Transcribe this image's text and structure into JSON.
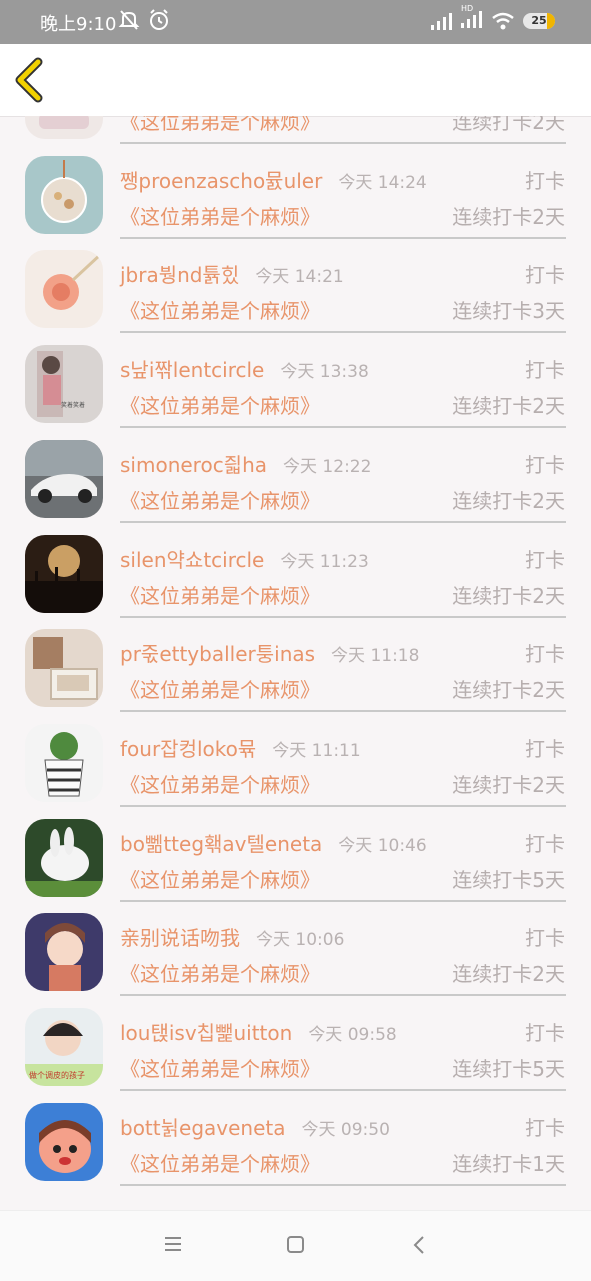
{
  "status_bar": {
    "time": "晚上9:10",
    "battery": "25",
    "network_badge": "HD"
  },
  "header": {
    "back_icon": "chevron-left-icon",
    "accent_color": "#f2d200"
  },
  "records": [
    {
      "name": "",
      "time": "",
      "action": "",
      "book": "《这位弟弟是个麻烦》",
      "streak": "连续打卡2天",
      "avatar": "clock"
    },
    {
      "name": "쨍proenzascho뮰uler",
      "time": "今天 14:24",
      "action": "打卡",
      "book": "《这位弟弟是个麻烦》",
      "streak": "连续打卡2天",
      "avatar": "jar"
    },
    {
      "name": "jbra붱nd튥힜",
      "time": "今天 14:21",
      "action": "打卡",
      "book": "《这位弟弟是个麻烦》",
      "streak": "连续打卡3天",
      "avatar": "flower"
    },
    {
      "name": "s낲i짞lentcircle",
      "time": "今天 13:38",
      "action": "打卡",
      "book": "《这位弟弟是个麻烦》",
      "streak": "连续打卡2天",
      "avatar": "girl"
    },
    {
      "name": "simoneroc즯ha",
      "time": "今天 12:22",
      "action": "打卡",
      "book": "《这位弟弟是个麻烦》",
      "streak": "连续打卡2天",
      "avatar": "car"
    },
    {
      "name": "silen약쇼tcircle",
      "time": "今天 11:23",
      "action": "打卡",
      "book": "《这位弟弟是个麻烦》",
      "streak": "连续打卡2天",
      "avatar": "crowd"
    },
    {
      "name": "pr죿ettyballer퉁inas",
      "time": "今天 11:18",
      "action": "打卡",
      "book": "《这位弟弟是个麻烦》",
      "streak": "连续打卡2天",
      "avatar": "box"
    },
    {
      "name": "four잡컹loko뮦",
      "time": "今天 11:11",
      "action": "打卡",
      "book": "《这位弟弟是个麻烦》",
      "streak": "连续打卡2天",
      "avatar": "cactus"
    },
    {
      "name": "bo뻶tteg홲av텔eneta",
      "time": "今天 10:46",
      "action": "打卡",
      "book": "《这位弟弟是个麻烦》",
      "streak": "连续打卡5天",
      "avatar": "rabbit"
    },
    {
      "name": "亲别说话吻我",
      "time": "今天 10:06",
      "action": "打卡",
      "book": "《这位弟弟是个麻烦》",
      "streak": "连续打卡2天",
      "avatar": "anime"
    },
    {
      "name": "lou탡isv칩뺉uitton",
      "time": "今天 09:58",
      "action": "打卡",
      "book": "《这位弟弟是个麻烦》",
      "streak": "连续打卡5天",
      "avatar": "child"
    },
    {
      "name": "bott뉡egaveneta",
      "time": "今天 09:50",
      "action": "打卡",
      "book": "《这位弟弟是个麻烦》",
      "streak": "连续打卡1天",
      "avatar": "cartoon"
    }
  ],
  "nav_bar": {
    "menu_icon": "menu-icon",
    "home_icon": "square-home-icon",
    "back_icon": "triangle-back-icon"
  }
}
